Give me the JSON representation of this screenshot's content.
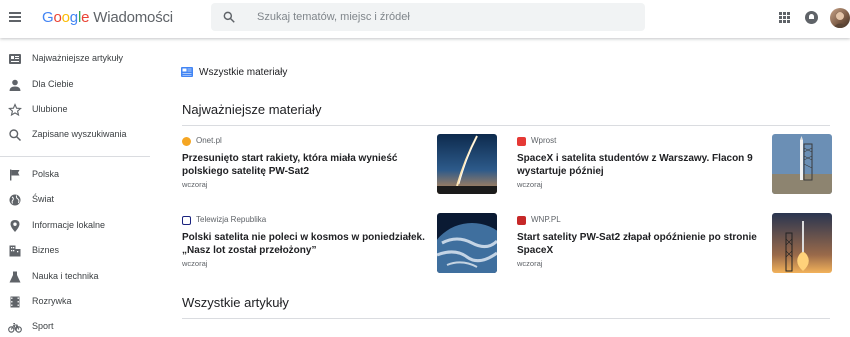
{
  "header": {
    "logo_word": [
      "G",
      "o",
      "o",
      "g",
      "l",
      "e"
    ],
    "logo_colors": [
      "#4285f4",
      "#ea4335",
      "#fbbc05",
      "#4285f4",
      "#34a853",
      "#ea4335"
    ],
    "product_name": "Wiadomości",
    "search_placeholder": "Szukaj tematów, miejsc i źródeł"
  },
  "sidebar": {
    "items": [
      {
        "label": "Najważniejsze artykuły",
        "icon": "top-stories-icon"
      },
      {
        "label": "Dla Ciebie",
        "icon": "person-icon"
      },
      {
        "label": "Ulubione",
        "icon": "star-icon"
      },
      {
        "label": "Zapisane wyszukiwania",
        "icon": "search-icon"
      },
      {
        "label": "Polska",
        "icon": "flag-icon"
      },
      {
        "label": "Świat",
        "icon": "globe-icon"
      },
      {
        "label": "Informacje lokalne",
        "icon": "location-pin-icon"
      },
      {
        "label": "Biznes",
        "icon": "building-icon"
      },
      {
        "label": "Nauka i technika",
        "icon": "flask-icon"
      },
      {
        "label": "Rozrywka",
        "icon": "film-icon"
      },
      {
        "label": "Sport",
        "icon": "bicycle-icon"
      }
    ]
  },
  "main": {
    "breadcrumb": "Wszystkie materiały",
    "top_section_title": "Najważniejsze materiały",
    "all_section_title": "Wszystkie artykuły",
    "cards": [
      {
        "source": "Onet.pl",
        "source_color": "#f5a623",
        "title": "Przesunięto start rakiety, która miała wynieść polskiego satelitę PW-Sat2",
        "time": "wczoraj"
      },
      {
        "source": "Wprost",
        "source_color": "#e53935",
        "title": "SpaceX i satelita studentów z Warszawy. Flacon 9 wystartuje później",
        "time": "wczoraj"
      },
      {
        "source": "Telewizja Republika",
        "source_color": "#1a237e",
        "title": "Polski satelita nie poleci w kosmos w poniedziałek. „Nasz lot został przełożony”",
        "time": "wczoraj"
      },
      {
        "source": "WNP.PL",
        "source_color": "#c62828",
        "title": "Start satelity PW-Sat2 złapał opóźnienie po stronie SpaceX",
        "time": "wczoraj"
      }
    ]
  }
}
